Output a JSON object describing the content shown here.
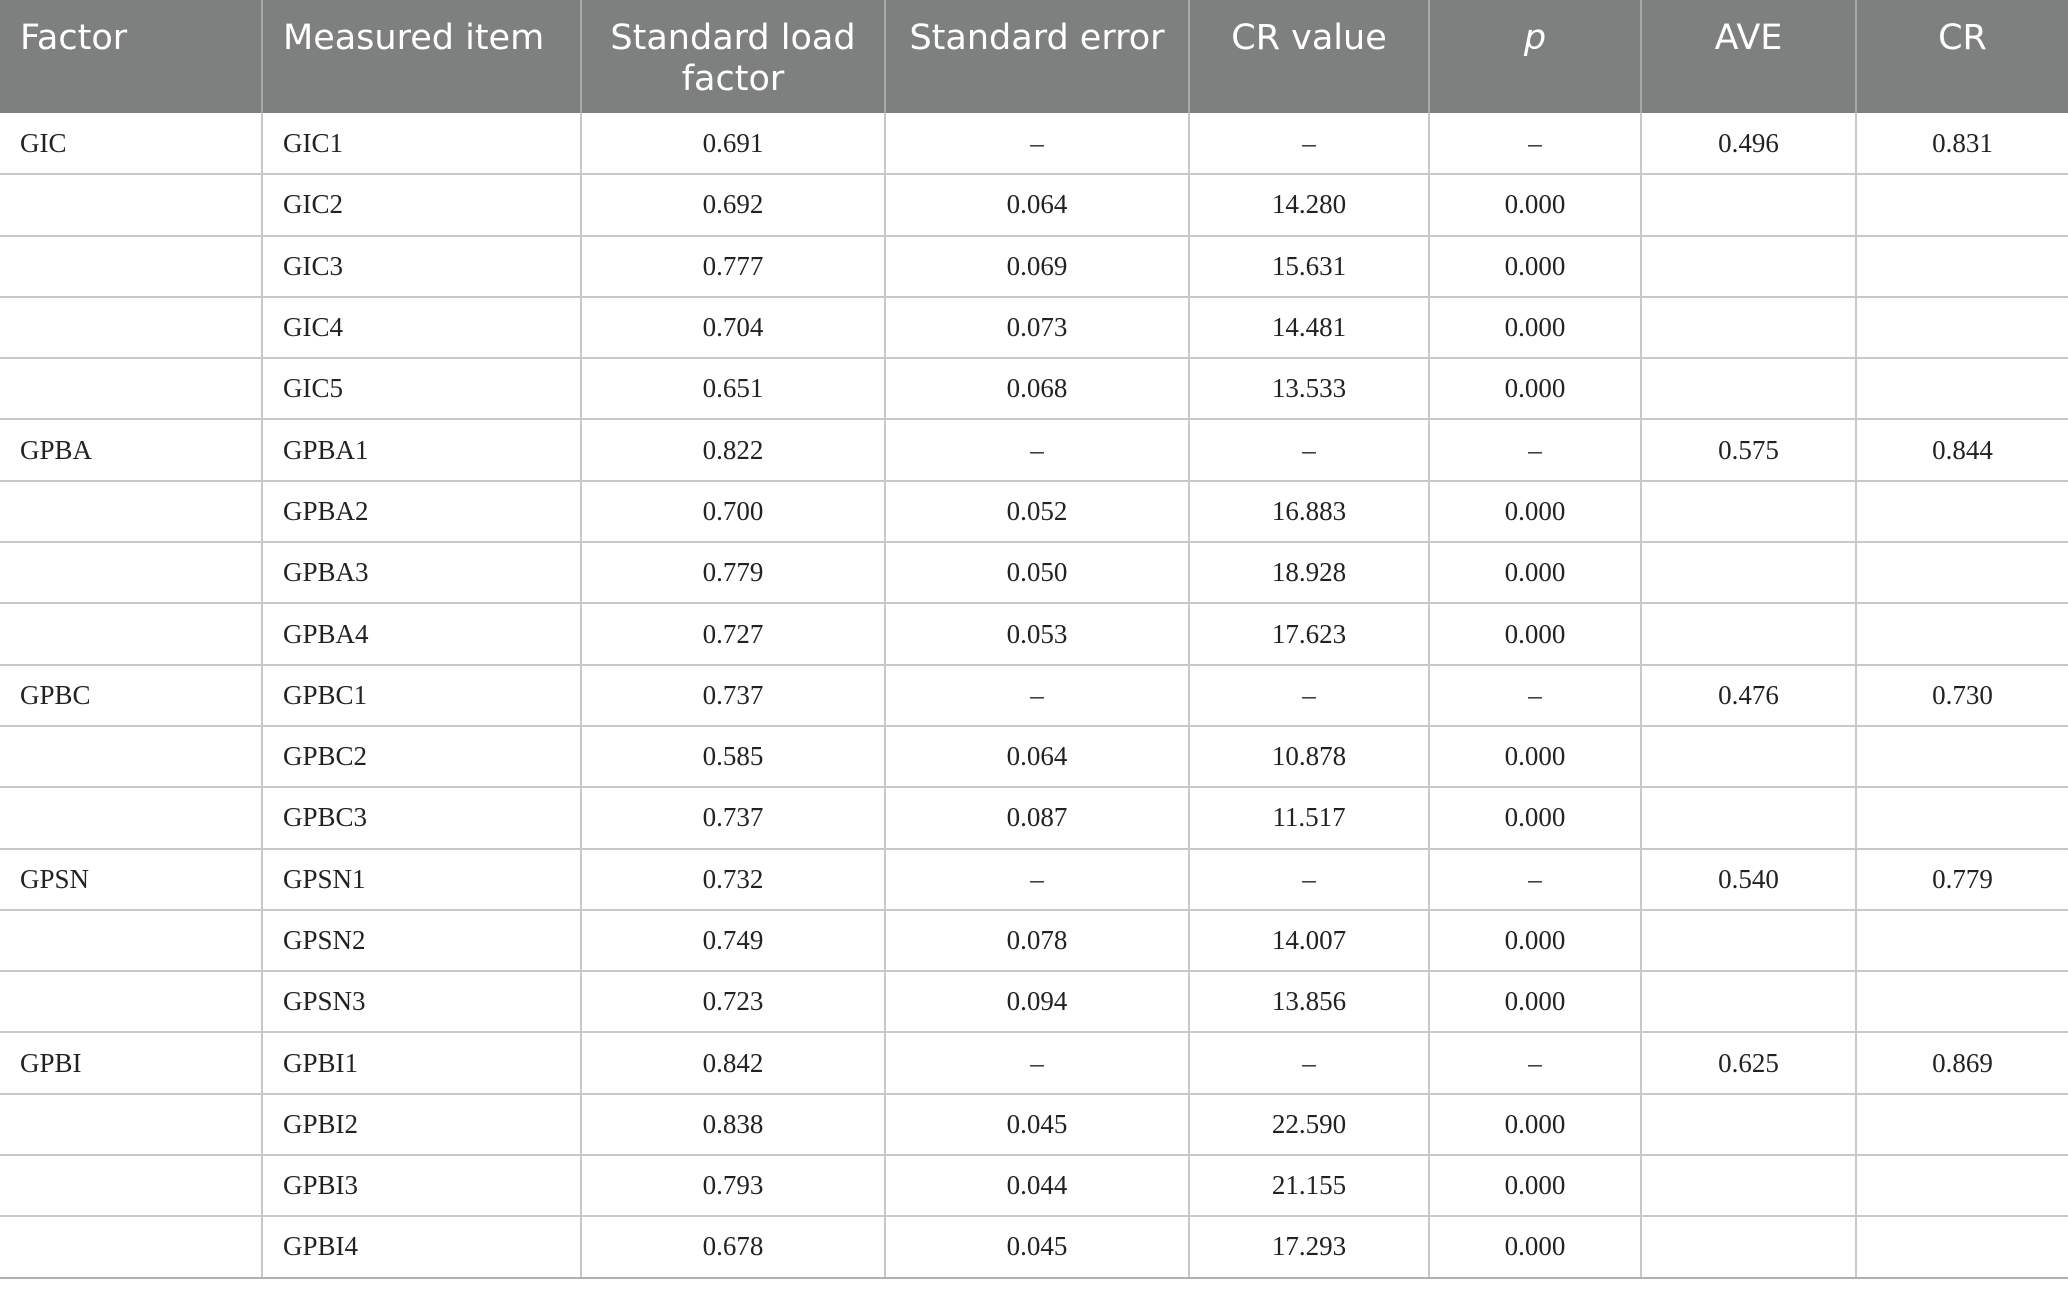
{
  "table": {
    "headers": [
      {
        "key": "factor",
        "label": "Factor",
        "align": "left"
      },
      {
        "key": "item",
        "label": "Measured item",
        "align": "left"
      },
      {
        "key": "load",
        "label": "Standard load factor",
        "align": "center"
      },
      {
        "key": "se",
        "label": "Standard error",
        "align": "center"
      },
      {
        "key": "crv",
        "label": "CR value",
        "align": "center"
      },
      {
        "key": "p",
        "label": "p",
        "align": "center"
      },
      {
        "key": "ave",
        "label": "AVE",
        "align": "center"
      },
      {
        "key": "cr",
        "label": "CR",
        "align": "center"
      }
    ],
    "rows": [
      [
        "GIC",
        "GIC1",
        "0.691",
        "–",
        "–",
        "–",
        "0.496",
        "0.831"
      ],
      [
        "",
        "GIC2",
        "0.692",
        "0.064",
        "14.280",
        "0.000",
        "",
        ""
      ],
      [
        "",
        "GIC3",
        "0.777",
        "0.069",
        "15.631",
        "0.000",
        "",
        ""
      ],
      [
        "",
        "GIC4",
        "0.704",
        "0.073",
        "14.481",
        "0.000",
        "",
        ""
      ],
      [
        "",
        "GIC5",
        "0.651",
        "0.068",
        "13.533",
        "0.000",
        "",
        ""
      ],
      [
        "GPBA",
        "GPBA1",
        "0.822",
        "–",
        "–",
        "–",
        "0.575",
        "0.844"
      ],
      [
        "",
        "GPBA2",
        "0.700",
        "0.052",
        "16.883",
        "0.000",
        "",
        ""
      ],
      [
        "",
        "GPBA3",
        "0.779",
        "0.050",
        "18.928",
        "0.000",
        "",
        ""
      ],
      [
        "",
        "GPBA4",
        "0.727",
        "0.053",
        "17.623",
        "0.000",
        "",
        ""
      ],
      [
        "GPBC",
        "GPBC1",
        "0.737",
        "–",
        "–",
        "–",
        "0.476",
        "0.730"
      ],
      [
        "",
        "GPBC2",
        "0.585",
        "0.064",
        "10.878",
        "0.000",
        "",
        ""
      ],
      [
        "",
        "GPBC3",
        "0.737",
        "0.087",
        "11.517",
        "0.000",
        "",
        ""
      ],
      [
        "GPSN",
        "GPSN1",
        "0.732",
        "–",
        "–",
        "–",
        "0.540",
        "0.779"
      ],
      [
        "",
        "GPSN2",
        "0.749",
        "0.078",
        "14.007",
        "0.000",
        "",
        ""
      ],
      [
        "",
        "GPSN3",
        "0.723",
        "0.094",
        "13.856",
        "0.000",
        "",
        ""
      ],
      [
        "GPBI",
        "GPBI1",
        "0.842",
        "–",
        "–",
        "–",
        "0.625",
        "0.869"
      ],
      [
        "",
        "GPBI2",
        "0.838",
        "0.045",
        "22.590",
        "0.000",
        "",
        ""
      ],
      [
        "",
        "GPBI3",
        "0.793",
        "0.044",
        "21.155",
        "0.000",
        "",
        ""
      ],
      [
        "",
        "GPBI4",
        "0.678",
        "0.045",
        "17.293",
        "0.000",
        "",
        ""
      ]
    ]
  },
  "colors": {
    "header_bg": "#7e807f",
    "header_text": "#ffffff",
    "grid": "#c8c8c8"
  }
}
